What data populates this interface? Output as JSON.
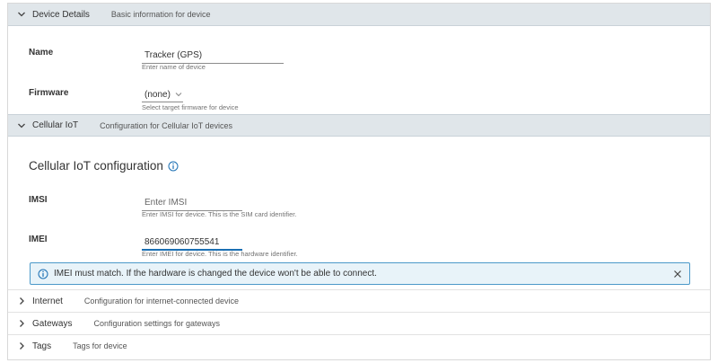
{
  "sections": {
    "device_details": {
      "title": "Device Details",
      "description": "Basic information for device"
    },
    "cellular": {
      "title": "Cellular IoT",
      "description": "Configuration for Cellular IoT devices"
    },
    "internet": {
      "title": "Internet",
      "description": "Configuration for internet-connected device"
    },
    "gateways": {
      "title": "Gateways",
      "description": "Configuration settings for gateways"
    },
    "tags": {
      "title": "Tags",
      "description": "Tags for device"
    }
  },
  "device": {
    "name_label": "Name",
    "name_value": "Tracker (GPS)",
    "name_hint": "Enter name of device",
    "firmware_label": "Firmware",
    "firmware_value": "(none)",
    "firmware_hint": "Select target firmware for device"
  },
  "cellular_config": {
    "heading": "Cellular IoT configuration",
    "imsi_label": "IMSI",
    "imsi_placeholder": "Enter IMSI",
    "imsi_hint": "Enter IMSI for device. This is the SIM card identifier.",
    "imei_label": "IMEI",
    "imei_value": "866069060755541",
    "imei_hint": "Enter IMEI for device. This is the hardware identifier."
  },
  "alert": {
    "text": "IMEI must match. If the hardware is changed the device won't be able to connect."
  },
  "colors": {
    "header_bg": "#e0e6ea",
    "info_blue": "#1a6fb3",
    "alert_bg": "#e8f3f9",
    "alert_border": "#4b99c9"
  },
  "icons": {
    "expanded": "chevron-down-icon",
    "collapsed": "chevron-right-icon",
    "info": "info-icon",
    "close": "close-icon"
  }
}
